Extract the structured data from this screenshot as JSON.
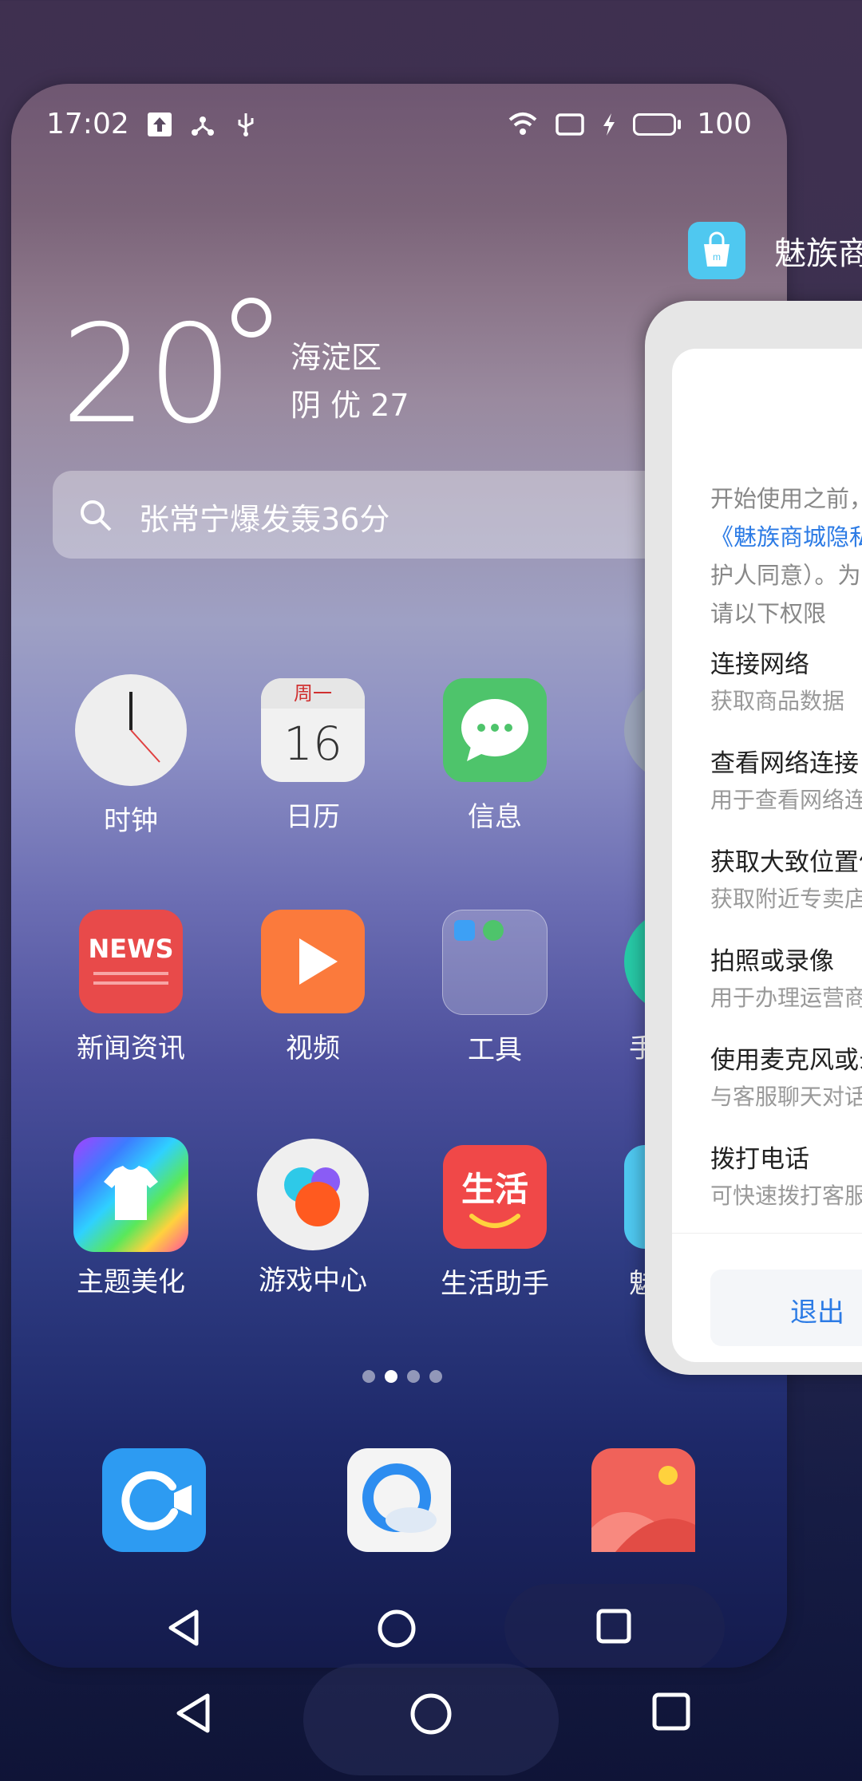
{
  "status_bar": {
    "time": "17:02",
    "battery_level": "100"
  },
  "weather": {
    "temperature": "20",
    "location": "海淀区",
    "condition": "阴  优 27"
  },
  "search": {
    "placeholder": "张常宁爆发轰36分"
  },
  "apps_row1": [
    {
      "label": "时钟",
      "icon": "clock-icon"
    },
    {
      "label": "日历",
      "icon": "calendar-icon",
      "weekday": "周一",
      "day": "16"
    },
    {
      "label": "信息",
      "icon": "messages-icon"
    }
  ],
  "apps_row2": [
    {
      "label": "新闻资讯",
      "icon": "news-icon",
      "badge": "NEWS"
    },
    {
      "label": "视频",
      "icon": "video-icon"
    },
    {
      "label": "工具",
      "icon": "tools-folder-icon"
    },
    {
      "label": "手",
      "icon": "partial-app-icon"
    }
  ],
  "apps_row3": [
    {
      "label": "主题美化",
      "icon": "theme-icon"
    },
    {
      "label": "游戏中心",
      "icon": "game-center-icon"
    },
    {
      "label": "生活助手",
      "icon": "life-assistant-icon",
      "tile_text": "生活"
    },
    {
      "label": "魅",
      "icon": "partial-app-icon"
    }
  ],
  "dock": [
    {
      "icon": "camera-app-icon"
    },
    {
      "icon": "browser-icon"
    },
    {
      "icon": "gallery-icon"
    }
  ],
  "page_dots": {
    "count": 4,
    "active": 1
  },
  "store": {
    "title": "魅族商",
    "intro_line1": "开始使用之前，",
    "intro_link": "《魅族商城隐私",
    "intro_line2": "护人同意）。为",
    "intro_line3": "请以下权限",
    "permissions": [
      {
        "title": "连接网络",
        "desc": "获取商品数据"
      },
      {
        "title": "查看网络连接",
        "desc": "用于查看网络连"
      },
      {
        "title": "获取大致位置信",
        "desc": "获取附近专卖店"
      },
      {
        "title": "拍照或录像",
        "desc": "用于办理运营商"
      },
      {
        "title": "使用麦克风或录",
        "desc": "与客服聊天对话"
      },
      {
        "title": "拨打电话",
        "desc": "可快速拨打客服"
      }
    ],
    "exit_label": "退出"
  },
  "colors": {
    "accent": "#2c7be5",
    "battery": "#35d235"
  }
}
